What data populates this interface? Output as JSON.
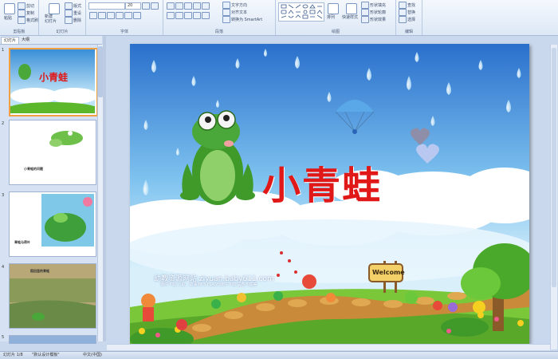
{
  "ribbon": {
    "clipboard": {
      "paste": "粘贴",
      "cut": "剪切",
      "copy": "复制",
      "format_painter": "格式刷",
      "label": "剪贴板"
    },
    "slides": {
      "new_slide": "新建\n幻灯片",
      "layout": "版式",
      "reset": "重设",
      "delete": "删除",
      "label": "幻灯片"
    },
    "font": {
      "font_name": "",
      "font_size": "20",
      "label": "字体"
    },
    "paragraph": {
      "text_direction": "文字方向",
      "align_text": "对齐文本",
      "convert_smartart": "转换为 SmartArt",
      "label": "段落"
    },
    "drawing": {
      "arrange": "排列",
      "quick_styles": "快速样式",
      "shape_fill": "形状填充",
      "shape_outline": "形状轮廓",
      "shape_effects": "形状效果",
      "label": "绘图"
    },
    "editing": {
      "find": "查找",
      "replace": "替换",
      "select": "选择",
      "label": "编辑"
    }
  },
  "panel_tabs": {
    "slides": "幻灯片",
    "outline": "大纲"
  },
  "thumbnails": [
    {
      "number": "1",
      "caption": "小青蛙"
    },
    {
      "number": "2",
      "caption": "小青蛙的问题"
    },
    {
      "number": "3",
      "caption": "青蛙与荷叶"
    },
    {
      "number": "4",
      "caption": "稻田里的青蛙"
    },
    {
      "number": "5",
      "caption": ""
    }
  ],
  "slide": {
    "title": "小青蛙",
    "site_name": "幼教资源网站  ziyuan.baby611.com",
    "site_sub": "课件下载   儿歌、故事MP3   FLASH课件下载   试卷下载等",
    "sign": "Welcome"
  },
  "status": {
    "slide_count": "幻灯片 1/8",
    "theme": "\"默认设计模板\"",
    "language": "中文(中国)"
  },
  "colors": {
    "title_red": "#e01818",
    "accent": "#2a64b8"
  }
}
